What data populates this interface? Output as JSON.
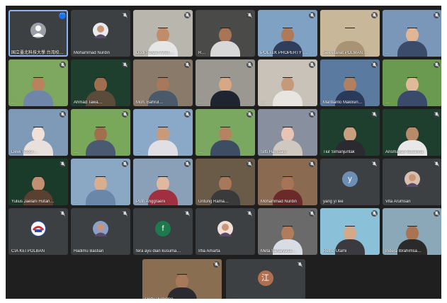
{
  "tiles": [
    {
      "name": "国立臺北科技大學 台湾校友…",
      "kind": "avatar-user",
      "color": "#9aa0a6",
      "icon": "more-options-icon",
      "active": true
    },
    {
      "name": "Mohammad Nurdin",
      "kind": "photo-avatar",
      "color": "#e8eaed"
    },
    {
      "name": "Dodi Sofyan Arief,…",
      "kind": "video",
      "bg": "#b9b6ad",
      "skin": "#c28c6a",
      "shirt": "#e6e6e6"
    },
    {
      "name": "R…",
      "kind": "video",
      "bg": "#4a4a48",
      "skin": "#a87656",
      "shirt": "#d8d8d8"
    },
    {
      "name": "POLTEK PROPERTY …",
      "kind": "video",
      "bg": "#7fa2c4",
      "skin": "#b07a58",
      "shirt": "#2f3e5c"
    },
    {
      "name": "Sekretariat POLMAN …",
      "kind": "video",
      "bg": "#c9b79a",
      "skin": "#c9b79a",
      "shirt": "#a89374"
    },
    {
      "name": "…",
      "kind": "video",
      "bg": "#7a96b8",
      "skin": "#e0b694",
      "shirt": "#3a4c6a"
    },
    {
      "name": "…",
      "kind": "video",
      "bg": "#7ea860",
      "skin": "#b8825e",
      "shirt": "#6f86a8"
    },
    {
      "name": "Ahmad Tawa…",
      "kind": "video",
      "bg": "#1e3e2e",
      "skin": "#a06e4e",
      "shirt": "#5b4b3b"
    },
    {
      "name": "Moh. Bahrul…",
      "kind": "video",
      "bg": "#8a7a6a",
      "skin": "#a8785a",
      "shirt": "#4a5a6a"
    },
    {
      "name": "…",
      "kind": "video",
      "bg": "#9a9890",
      "skin": "#d8a884",
      "shirt": "#1e2430"
    },
    {
      "name": "…",
      "kind": "video",
      "bg": "#c8c2b8",
      "skin": "#c49a7a",
      "shirt": "#e8e4e0"
    },
    {
      "name": "Mantianto Maklisin…",
      "kind": "video",
      "bg": "#5a7aa0",
      "skin": "#b08060",
      "shirt": "#2a3a5a"
    },
    {
      "name": "…",
      "kind": "video",
      "bg": "#6a9a50",
      "skin": "#e0b89a",
      "shirt": "#3a4a6a"
    },
    {
      "name": "Dewi Sobur…",
      "kind": "video",
      "bg": "#7e9ab6",
      "skin": "#f0e0d8",
      "shirt": "#e8e0dc"
    },
    {
      "name": "…",
      "kind": "video",
      "bg": "#7aa85a",
      "skin": "#a0704e",
      "shirt": "#4a5a70"
    },
    {
      "name": "…",
      "kind": "video",
      "bg": "#8aa8c8",
      "skin": "#c89a7a",
      "shirt": "#e0e0e4"
    },
    {
      "name": "…",
      "kind": "video",
      "bg": "#7aa860",
      "skin": "#b48462",
      "shirt": "#3e4e62"
    },
    {
      "name": "Sitti Hamdani",
      "kind": "video",
      "bg": "#8890a0",
      "skin": "#e8c4b4",
      "shirt": "#cfc8c0"
    },
    {
      "name": "Tiur Simanjuntak",
      "kind": "video",
      "bg": "#1e3e2e",
      "skin": "#c8a080",
      "shirt": "#2a2a30"
    },
    {
      "name": "Arismayati Susanna",
      "kind": "video",
      "bg": "#1e3e2e",
      "skin": "#b88a6a",
      "shirt": "#e8e8e8"
    },
    {
      "name": "Yulius Jaelani Hutan…",
      "kind": "video",
      "bg": "#1a3a2a",
      "skin": "#c09070",
      "shirt": "#5a4030"
    },
    {
      "name": "…",
      "kind": "video",
      "bg": "#8aa8c4",
      "skin": "#d8ae8e",
      "shirt": "#6a86a8"
    },
    {
      "name": "Putri Anggraeni",
      "kind": "video",
      "bg": "#8aa0b8",
      "skin": "#e0b8a0",
      "shirt": "#a03040"
    },
    {
      "name": "Untung Rama…",
      "kind": "video",
      "bg": "#6a5a48",
      "skin": "#a8785a",
      "shirt": "#3a3a3a"
    },
    {
      "name": "Mohammad Nurdin",
      "kind": "video",
      "bg": "#8a6a50",
      "skin": "#a87456",
      "shirt": "#6a2a2a"
    },
    {
      "name": "yang yi lee",
      "kind": "initial",
      "initial": "y",
      "color": "#6d8fb3"
    },
    {
      "name": "Vita Arumsari",
      "kind": "photo-avatar",
      "color": "#d8c0b0"
    },
    {
      "name": "CIA KEI POLBAN",
      "kind": "logo",
      "color": "#2d4fa8"
    },
    {
      "name": "Hadimu Bastian",
      "kind": "photo-avatar",
      "color": "#8aa0c8"
    },
    {
      "name": "fera ayu dian kusuma…",
      "kind": "initial",
      "initial": "f",
      "color": "#1e7a4e"
    },
    {
      "name": "Irtia Amarta",
      "kind": "photo-avatar",
      "color": "#f0e0d8"
    },
    {
      "name": "Meta Saharyasa…",
      "kind": "video",
      "bg": "#6a6a6a",
      "skin": "#b07c5c",
      "shirt": "#d8dce4"
    },
    {
      "name": "Retno Utami",
      "kind": "video",
      "bg": "#8ac0d8",
      "skin": "#d4a888",
      "shirt": "#3a3a40"
    },
    {
      "name": "Indera Ibrahimsa…",
      "kind": "video",
      "bg": "#8aa8b8",
      "skin": "#a87454",
      "shirt": "#2a2a2a"
    }
  ],
  "bottom": [
    {
      "name": "Dedy Purnomo…",
      "kind": "video",
      "bg": "#8a6e52",
      "skin": "#a8785a",
      "shirt": "#2a2a30"
    },
    {
      "name": "…",
      "kind": "initial",
      "initial": "江",
      "color": "#b07050"
    }
  ]
}
